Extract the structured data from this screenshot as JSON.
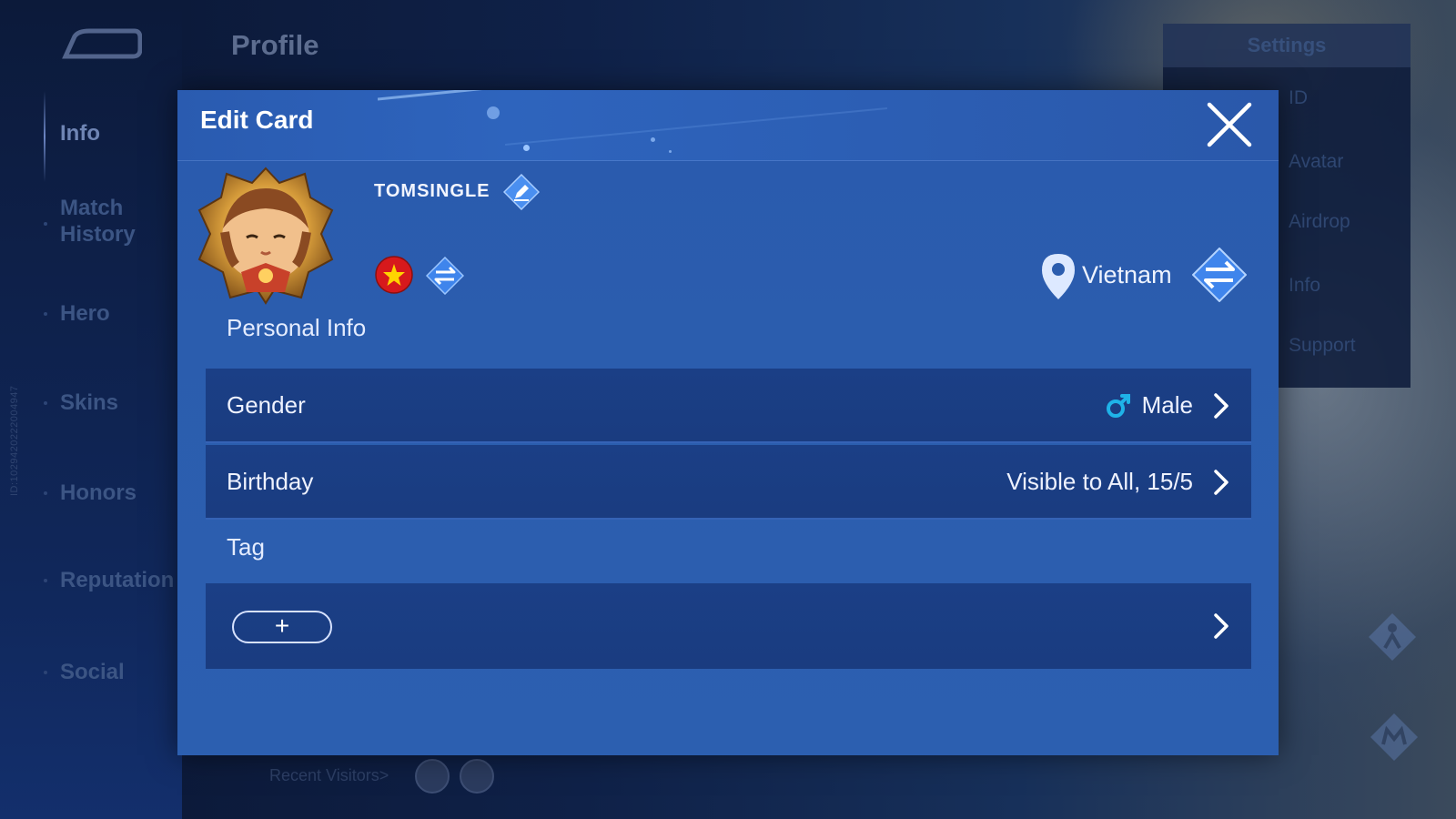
{
  "background": {
    "page_title": "Profile",
    "nav_items": [
      {
        "label": "Info",
        "active": true
      },
      {
        "label": "Match History",
        "line2": "History",
        "line1": "Match"
      },
      {
        "label": "Hero"
      },
      {
        "label": "Skins"
      },
      {
        "label": "Honors"
      },
      {
        "label": "Reputation"
      },
      {
        "label": "Social"
      }
    ],
    "vertical_id": "ID:1029420222004947",
    "right_menu": {
      "header": "Settings",
      "items": [
        "ID",
        "Avatar",
        "Airdrop",
        "Info",
        "Support"
      ]
    },
    "recent_visitors_label": "Recent Visitors>"
  },
  "dialog": {
    "title": "Edit Card",
    "player_name": "TOMSINGLE",
    "location": "Vietnam",
    "personal_info_label": "Personal Info",
    "rows": {
      "gender": {
        "label": "Gender",
        "value": "Male"
      },
      "birthday": {
        "label": "Birthday",
        "value": "Visible to All, 15/5"
      }
    },
    "tag_label": "Tag",
    "add_tag_label": "+"
  },
  "icons": {
    "close": "close-icon",
    "edit_name": "pencil-icon",
    "flag": "vietnam-flag-icon",
    "swap": "swap-arrows-icon",
    "location": "location-pin-icon",
    "male": "male-icon",
    "chevron": "chevron-right-icon"
  },
  "colors": {
    "dialog_bg": "#2b5dae",
    "row_bg": "#1b3f86",
    "male_icon": "#1fb3e8",
    "flag_red": "#d7191c",
    "flag_star": "#ffd400"
  }
}
